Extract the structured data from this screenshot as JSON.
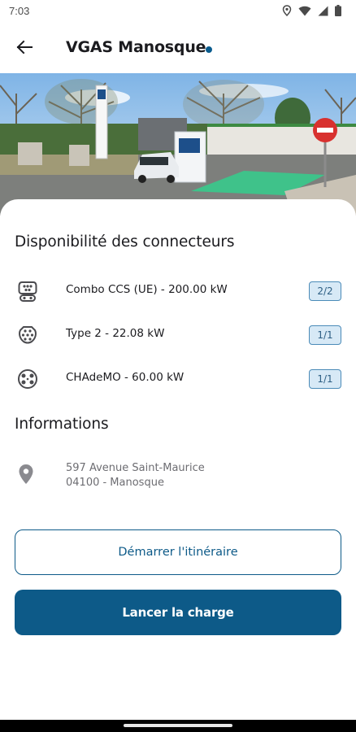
{
  "status_bar": {
    "time": "7:03",
    "icons": [
      "location-icon",
      "wifi-icon",
      "signal-icon",
      "battery-icon"
    ]
  },
  "header": {
    "back_icon": "arrow-left-icon",
    "title": "VGAS Manosque",
    "status_color": "#0a5c8e"
  },
  "photo": {
    "description_icon": "station-photo"
  },
  "connectors": {
    "title": "Disponibilité des connecteurs",
    "items": [
      {
        "icon": "combo-ccs-icon",
        "label": "Combo CCS (UE) - 200.00 kW",
        "availability": "2/2"
      },
      {
        "icon": "type2-icon",
        "label": "Type 2 - 22.08 kW",
        "availability": "1/1"
      },
      {
        "icon": "chademo-icon",
        "label": "CHAdeMO - 60.00 kW",
        "availability": "1/1"
      }
    ]
  },
  "informations": {
    "title": "Informations",
    "address_icon": "location-pin-icon",
    "address_line1": "597 Avenue Saint-Maurice",
    "address_line2": "04100 - Manosque"
  },
  "actions": {
    "itinerary_label": "Démarrer l'itinéraire",
    "charge_label": "Lancer la charge"
  },
  "colors": {
    "accent": "#0d5a88",
    "badge_bg": "#d7e9f6",
    "badge_border": "#4b8bb8"
  }
}
